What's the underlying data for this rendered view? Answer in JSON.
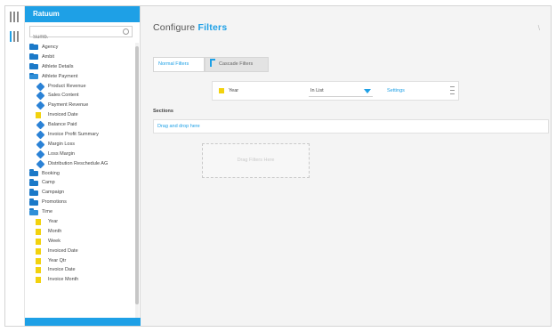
{
  "panel": {
    "title": "Ratuum",
    "search": {
      "value": "",
      "placeholder": "Sumb."
    }
  },
  "tree": [
    {
      "label": "Agency",
      "icon": "folder-icon",
      "level": 0
    },
    {
      "label": "Ambit",
      "icon": "folder-icon",
      "level": 0
    },
    {
      "label": "Athlete Details",
      "icon": "folder-icon",
      "level": 0
    },
    {
      "label": "Athlete Payment",
      "icon": "folder-open-icon",
      "level": 0
    },
    {
      "label": "Product Revenue",
      "icon": "dimension-icon",
      "level": 1
    },
    {
      "label": "Sales Content",
      "icon": "dimension-icon",
      "level": 1
    },
    {
      "label": "Payment Revenue",
      "icon": "dimension-icon",
      "level": 1
    },
    {
      "label": "Invoiced Date",
      "icon": "metric-icon",
      "level": 1
    },
    {
      "label": "Balance Paid",
      "icon": "dimension-icon",
      "level": 1
    },
    {
      "label": "Invoice Profit Summary",
      "icon": "dimension-icon",
      "level": 1
    },
    {
      "label": "Margin Loss",
      "icon": "dimension-icon",
      "level": 1
    },
    {
      "label": "Loss Margin",
      "icon": "dimension-icon",
      "level": 1
    },
    {
      "label": "Distribution Reschedule AG",
      "icon": "dimension-icon",
      "level": 1
    },
    {
      "label": "Booking",
      "icon": "folder-icon",
      "level": 0
    },
    {
      "label": "Camp",
      "icon": "folder-icon",
      "level": 0
    },
    {
      "label": "Campaign",
      "icon": "folder-icon",
      "level": 0
    },
    {
      "label": "Promotions",
      "icon": "folder-icon",
      "level": 0
    },
    {
      "label": "Time",
      "icon": "folder-open-icon",
      "level": 0
    },
    {
      "label": "Year",
      "icon": "metric-icon",
      "level": 1
    },
    {
      "label": "Month",
      "icon": "metric-icon",
      "level": 1
    },
    {
      "label": "Week",
      "icon": "metric-icon",
      "level": 1
    },
    {
      "label": "Invoiced Date",
      "icon": "metric-icon",
      "level": 1
    },
    {
      "label": "Year Qtr",
      "icon": "metric-icon",
      "level": 1
    },
    {
      "label": "Invoice Date",
      "icon": "metric-icon",
      "level": 1
    },
    {
      "label": "Invoice Month",
      "icon": "metric-icon",
      "level": 1
    }
  ],
  "main": {
    "title_prefix": "Configure",
    "title_highlight": "Filters",
    "close_label": "\\",
    "tabs": [
      {
        "label": "Normal Filters"
      },
      {
        "label": "Cascade Filters"
      }
    ],
    "filter_row": {
      "name": "Year",
      "operator": "In List",
      "link": "Settings"
    },
    "section_label": "Sections",
    "section_bar": "Drag and drop here",
    "drop_zone": "Drag Filters Here"
  },
  "colors": {
    "accent": "#1ea0e6",
    "folder": "#1b79c8",
    "metric": "#f2d20e",
    "background": "#f4f4f4"
  }
}
